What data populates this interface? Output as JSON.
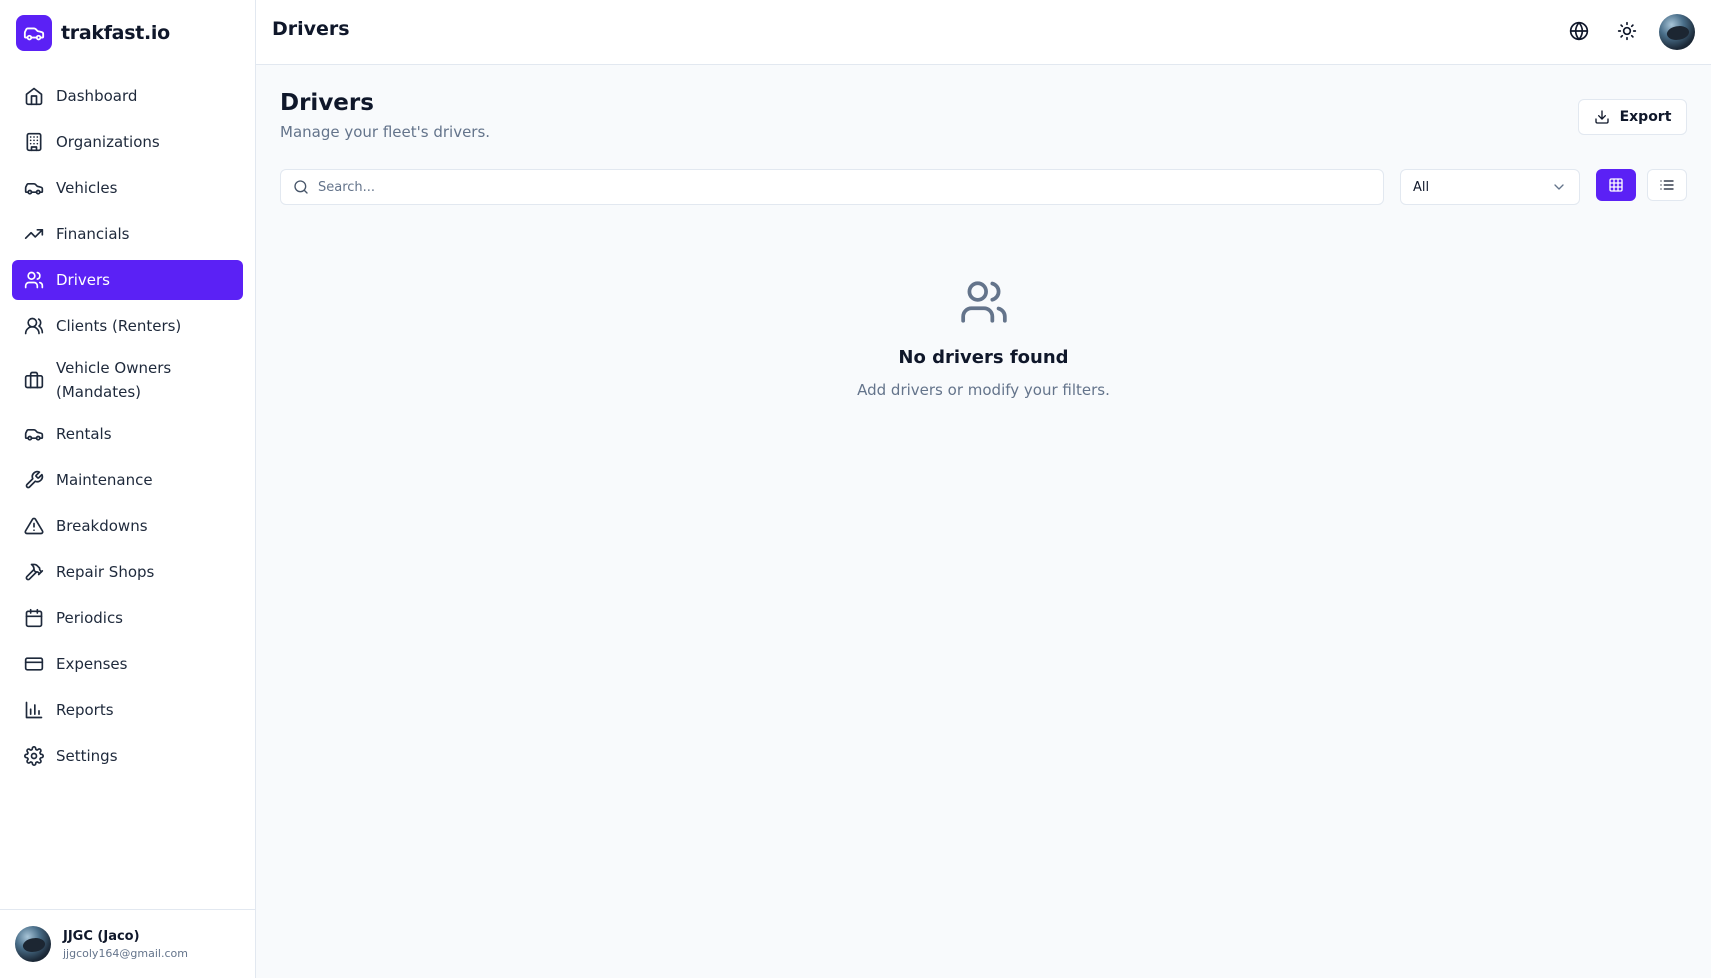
{
  "app": {
    "brand_name": "trakfast.io"
  },
  "sidebar": {
    "items": [
      {
        "label": "Dashboard",
        "icon": "home-icon"
      },
      {
        "label": "Organizations",
        "icon": "building-icon"
      },
      {
        "label": "Vehicles",
        "icon": "car-icon"
      },
      {
        "label": "Financials",
        "icon": "trending-up-icon"
      },
      {
        "label": "Drivers",
        "icon": "users-icon",
        "active": true
      },
      {
        "label": "Clients (Renters)",
        "icon": "users-icon"
      },
      {
        "label": "Vehicle Owners (Mandates)",
        "icon": "briefcase-icon"
      },
      {
        "label": "Rentals",
        "icon": "car-icon"
      },
      {
        "label": "Maintenance",
        "icon": "wrench-icon"
      },
      {
        "label": "Breakdowns",
        "icon": "alert-triangle-icon"
      },
      {
        "label": "Repair Shops",
        "icon": "hammer-icon"
      },
      {
        "label": "Periodics",
        "icon": "calendar-icon"
      },
      {
        "label": "Expenses",
        "icon": "credit-card-icon"
      },
      {
        "label": "Reports",
        "icon": "bar-chart-icon"
      },
      {
        "label": "Settings",
        "icon": "gear-icon"
      }
    ],
    "user": {
      "name": "JJGC (Jaco)",
      "email": "jjgcoly164@gmail.com"
    }
  },
  "header": {
    "title": "Drivers"
  },
  "main": {
    "title": "Drivers",
    "subtitle": "Manage your fleet's drivers.",
    "export_label": "Export",
    "search": {
      "placeholder": "Search...",
      "value": ""
    },
    "filter": {
      "selected": "All"
    },
    "empty_state": {
      "title": "No drivers found",
      "subtitle": "Add drivers or modify your filters."
    }
  },
  "colors": {
    "accent": "#5b21f5",
    "text": "#0f172a",
    "muted": "#64748b",
    "border": "#e2e8f0",
    "background": "#f8fafc"
  }
}
